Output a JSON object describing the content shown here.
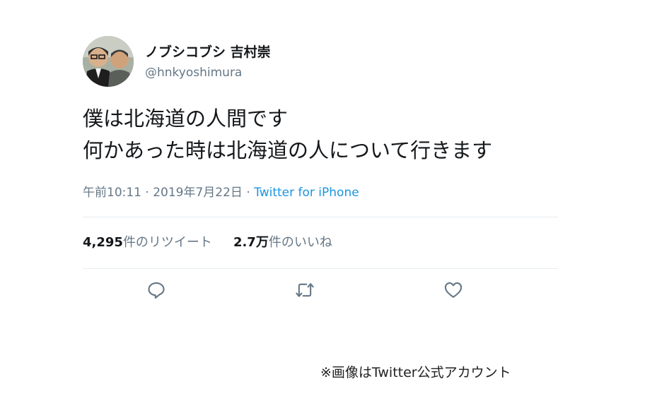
{
  "tweet": {
    "display_name": "ノブシコブシ 吉村崇",
    "handle": "@hnkyoshimura",
    "text_lines": [
      "僕は北海道の人間です",
      "何かあった時は北海道の人について行きます"
    ],
    "time": "午前10:11 · 2019年7月22日 · ",
    "source": "Twitter for iPhone",
    "retweet_count": "4,295",
    "retweet_label": "件のリツイート",
    "like_count": "2.7万",
    "like_label": "件のいいね"
  },
  "actions": {
    "reply_icon": "reply-icon",
    "retweet_icon": "retweet-icon",
    "like_icon": "heart-icon"
  },
  "caption": "※画像はTwitter公式アカウント",
  "colors": {
    "text": "#14171a",
    "secondary": "#657786",
    "link": "#1b95e0",
    "divider": "#e6ecf0"
  }
}
